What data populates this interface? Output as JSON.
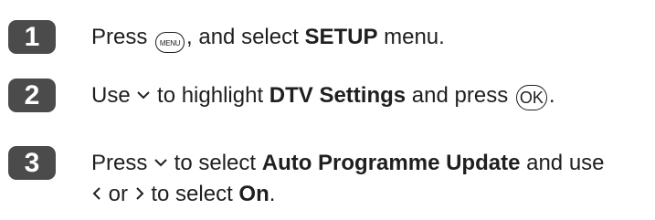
{
  "steps": [
    {
      "number": "1",
      "segments": {
        "s1": "Press ",
        "button_label": "MENU",
        "s2": ", and select ",
        "keyword": "SETUP",
        "s3": " menu."
      }
    },
    {
      "number": "2",
      "segments": {
        "s1": "Use ",
        "s2": " to highlight ",
        "keyword": "DTV Settings",
        "s3": " and press ",
        "button_label": "OK",
        "s4": "."
      }
    },
    {
      "number": "3",
      "line1": {
        "s1": "Press ",
        "s2": " to select ",
        "keyword": "Auto Programme Update",
        "s3": " and use"
      },
      "line2": {
        "s1": " or ",
        "s2": " to select ",
        "keyword": "On",
        "s3": "."
      }
    }
  ],
  "icons": {
    "menu_button": "menu-button-icon",
    "ok_button": "ok-button-icon",
    "down_arrow": "down-arrow-icon",
    "left_arrow": "left-arrow-icon",
    "right_arrow": "right-arrow-icon"
  }
}
